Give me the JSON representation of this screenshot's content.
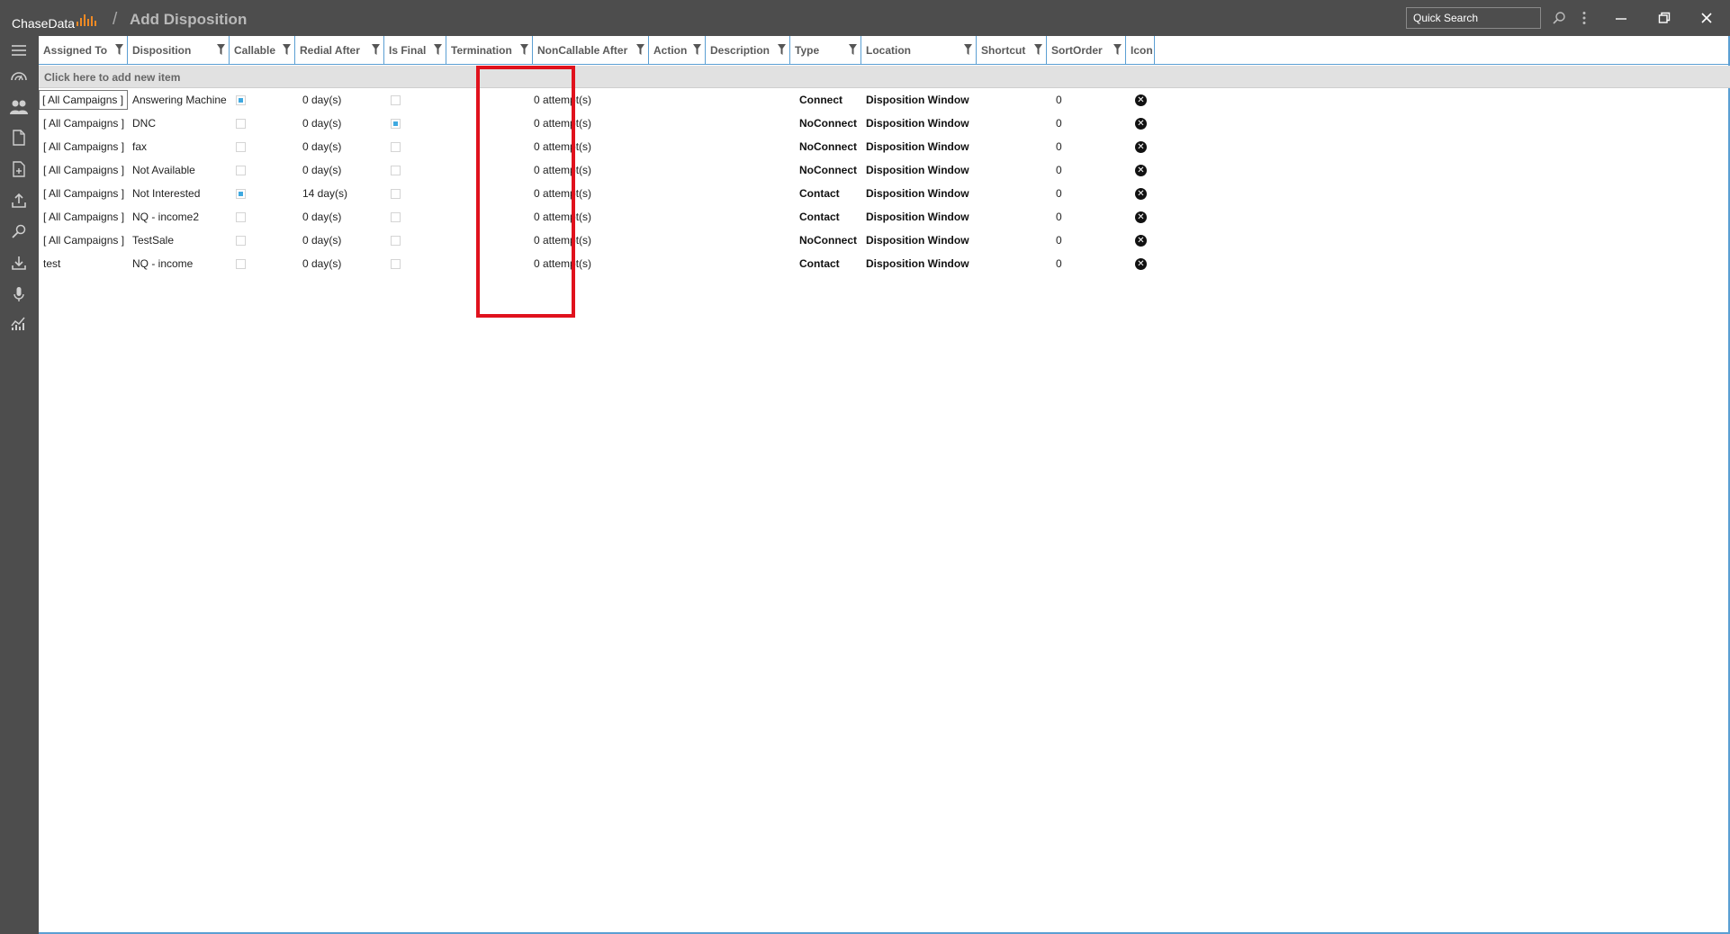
{
  "app": {
    "brand": "ChaseData",
    "breadcrumb_sep": "/",
    "title": "Add Disposition",
    "accent_color": "#f08a24",
    "header_color": "#4d4d4d"
  },
  "toolbar": {
    "search_placeholder": "Quick Search",
    "icons": [
      "search-icon",
      "more-vertical-icon",
      "minimize-icon",
      "restore-icon",
      "close-icon"
    ]
  },
  "rail": {
    "icons": [
      "menu-icon",
      "dashboard-icon",
      "users-icon",
      "document-icon",
      "add-document-icon",
      "upload-icon",
      "search-tool-icon",
      "download-icon",
      "microphone-icon",
      "reports-icon"
    ]
  },
  "grid": {
    "columns": [
      {
        "label": "Assigned To",
        "filter": true
      },
      {
        "label": "Disposition",
        "filter": true
      },
      {
        "label": "Callable",
        "filter": true
      },
      {
        "label": "Redial After",
        "filter": true
      },
      {
        "label": "Is Final",
        "filter": true
      },
      {
        "label": "Termination",
        "filter": true
      },
      {
        "label": "NonCallable After",
        "filter": true
      },
      {
        "label": "Action",
        "filter": true
      },
      {
        "label": "Description",
        "filter": true
      },
      {
        "label": "Type",
        "filter": true
      },
      {
        "label": "Location",
        "filter": true
      },
      {
        "label": "Shortcut",
        "filter": true
      },
      {
        "label": "SortOrder",
        "filter": true
      },
      {
        "label": "Icon",
        "filter": false
      }
    ],
    "add_row_label": "Click here to add new item",
    "rows": [
      {
        "assigned_to": "[ All Campaigns ]",
        "disposition": "Answering Machine",
        "callable": true,
        "redial_after": "0 day(s)",
        "is_final": false,
        "termination": "",
        "noncallable_after": "0 attempt(s)",
        "action": "",
        "description": "",
        "type": "Connect",
        "location": "Disposition Window",
        "shortcut": "",
        "sort_order": "0"
      },
      {
        "assigned_to": "[ All Campaigns ]",
        "disposition": "DNC",
        "callable": false,
        "redial_after": "0 day(s)",
        "is_final": true,
        "termination": "",
        "noncallable_after": "0 attempt(s)",
        "action": "",
        "description": "",
        "type": "NoConnect",
        "location": "Disposition Window",
        "shortcut": "",
        "sort_order": "0"
      },
      {
        "assigned_to": "[ All Campaigns ]",
        "disposition": "fax",
        "callable": false,
        "redial_after": "0 day(s)",
        "is_final": false,
        "termination": "",
        "noncallable_after": "0 attempt(s)",
        "action": "",
        "description": "",
        "type": "NoConnect",
        "location": "Disposition Window",
        "shortcut": "",
        "sort_order": "0"
      },
      {
        "assigned_to": "[ All Campaigns ]",
        "disposition": "Not Available",
        "callable": false,
        "redial_after": "0 day(s)",
        "is_final": false,
        "termination": "",
        "noncallable_after": "0 attempt(s)",
        "action": "",
        "description": "",
        "type": "NoConnect",
        "location": "Disposition Window",
        "shortcut": "",
        "sort_order": "0"
      },
      {
        "assigned_to": "[ All Campaigns ]",
        "disposition": "Not Interested",
        "callable": true,
        "redial_after": "14 day(s)",
        "is_final": false,
        "termination": "",
        "noncallable_after": "0 attempt(s)",
        "action": "",
        "description": "",
        "type": "Contact",
        "location": "Disposition Window",
        "shortcut": "",
        "sort_order": "0"
      },
      {
        "assigned_to": "[ All Campaigns ]",
        "disposition": "NQ - income2",
        "callable": false,
        "redial_after": "0 day(s)",
        "is_final": false,
        "termination": "",
        "noncallable_after": "0 attempt(s)",
        "action": "",
        "description": "",
        "type": "Contact",
        "location": "Disposition Window",
        "shortcut": "",
        "sort_order": "0"
      },
      {
        "assigned_to": "[ All Campaigns ]",
        "disposition": "TestSale",
        "callable": false,
        "redial_after": "0 day(s)",
        "is_final": false,
        "termination": "",
        "noncallable_after": "0 attempt(s)",
        "action": "",
        "description": "",
        "type": "NoConnect",
        "location": "Disposition Window",
        "shortcut": "",
        "sort_order": "0"
      },
      {
        "assigned_to": "test",
        "disposition": "NQ - income",
        "callable": false,
        "redial_after": "0 day(s)",
        "is_final": false,
        "termination": "",
        "noncallable_after": "0 attempt(s)",
        "action": "",
        "description": "",
        "type": "Contact",
        "location": "Disposition Window",
        "shortcut": "",
        "sort_order": "0"
      }
    ]
  },
  "annotation": {
    "highlight_color": "#e0121d",
    "highlighted_column": "Termination"
  }
}
